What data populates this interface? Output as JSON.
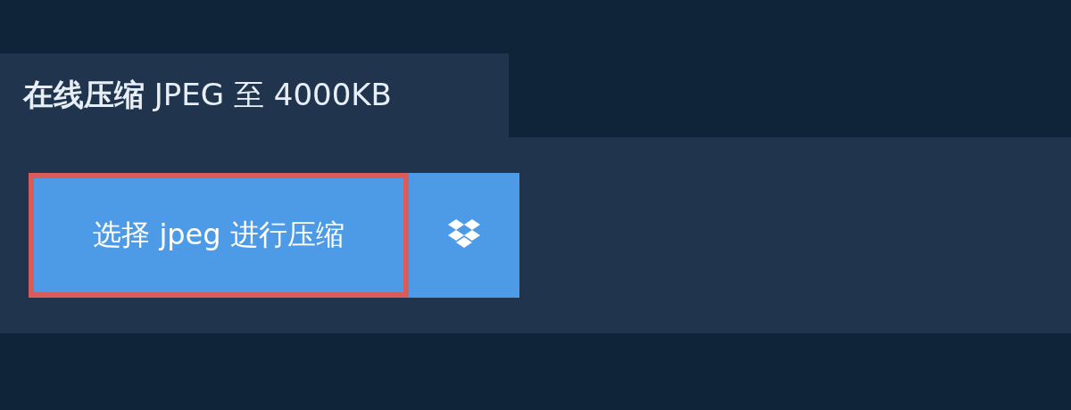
{
  "tab": {
    "title": "**在线压缩** JPEG 至 4000KB"
  },
  "upload_button": {
    "label": "选择 jpeg 进行压缩",
    "highlighted": true
  },
  "dropbox_button": {
    "kind": "dropbox"
  }
}
